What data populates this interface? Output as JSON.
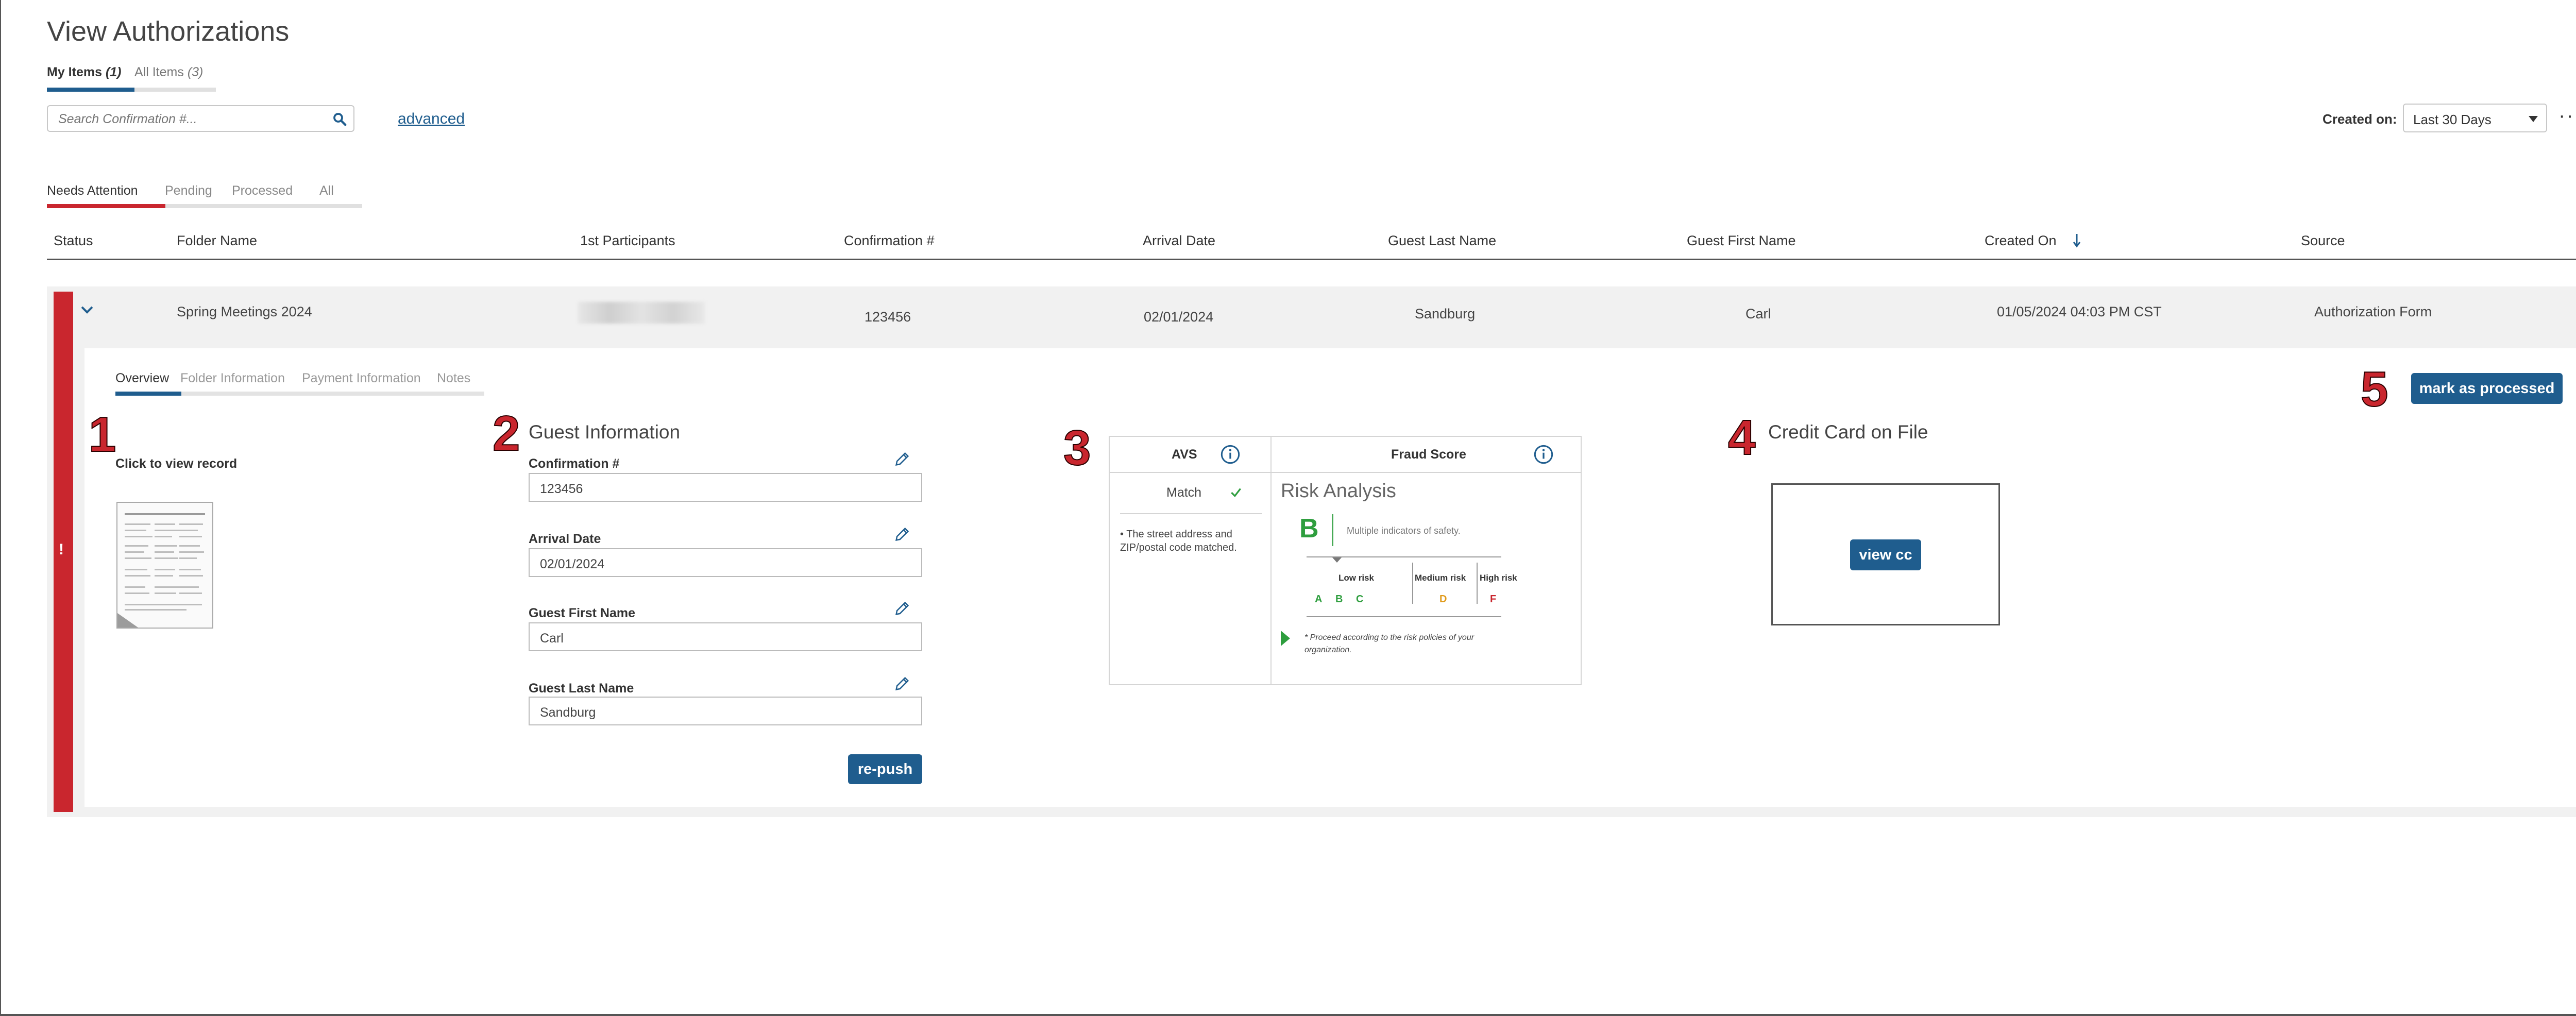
{
  "page": {
    "title": "View Authorizations"
  },
  "item_tabs": [
    {
      "label": "My Items",
      "count": "(1)"
    },
    {
      "label": "All Items",
      "count": "(3)"
    }
  ],
  "search": {
    "placeholder": "Search Confirmation #..."
  },
  "advanced_link": "advanced",
  "created_on": {
    "label": "Created on:",
    "value": "Last 30 Days"
  },
  "status_tabs": [
    "Needs Attention",
    "Pending",
    "Processed",
    "All"
  ],
  "table": {
    "columns": [
      "Status",
      "Folder Name",
      "1st Participants",
      "Confirmation #",
      "Arrival Date",
      "Guest Last Name",
      "Guest First Name",
      "Created On",
      "Source"
    ],
    "row": {
      "status_icon": "!",
      "folder": "Spring Meetings 2024",
      "confirmation": "123456",
      "arrival": "02/01/2024",
      "last_name": "Sandburg",
      "first_name": "Carl",
      "created_on": "01/05/2024 04:03 PM CST",
      "source": "Authorization Form"
    }
  },
  "detail_tabs": [
    "Overview",
    "Folder Information",
    "Payment Information",
    "Notes"
  ],
  "markers": [
    "1",
    "2",
    "3",
    "4",
    "5"
  ],
  "record": {
    "label": "Click to view record"
  },
  "guest_info": {
    "title": "Guest Information",
    "fields": [
      {
        "label": "Confirmation #",
        "value": "123456"
      },
      {
        "label": "Arrival Date",
        "value": "02/01/2024"
      },
      {
        "label": "Guest First Name",
        "value": "Carl"
      },
      {
        "label": "Guest Last Name",
        "value": "Sandburg"
      }
    ],
    "repush_label": "re-push"
  },
  "avs": {
    "title": "AVS",
    "result": "Match",
    "note": "• The street address and ZIP/postal code matched."
  },
  "fraud": {
    "title": "Fraud Score",
    "heading": "Risk Analysis",
    "grade": "B",
    "grade_desc": "Multiple indicators of safety.",
    "risk_groups": [
      {
        "label": "Low risk",
        "grades": [
          "A",
          "B",
          "C"
        ]
      },
      {
        "label": "Medium risk",
        "grades": [
          "D"
        ]
      },
      {
        "label": "High risk",
        "grades": [
          "F"
        ]
      }
    ],
    "note": "* Proceed according to the risk policies of your organization.",
    "colors": {
      "low": "#2e9e3e",
      "medium": "#e09a1a",
      "high": "#c9262e"
    }
  },
  "credit_card": {
    "title": "Credit Card on File",
    "button": "view cc"
  },
  "mark_processed": "mark as processed",
  "colors": {
    "primary": "#1f5d8e",
    "alert": "#c9262e"
  }
}
